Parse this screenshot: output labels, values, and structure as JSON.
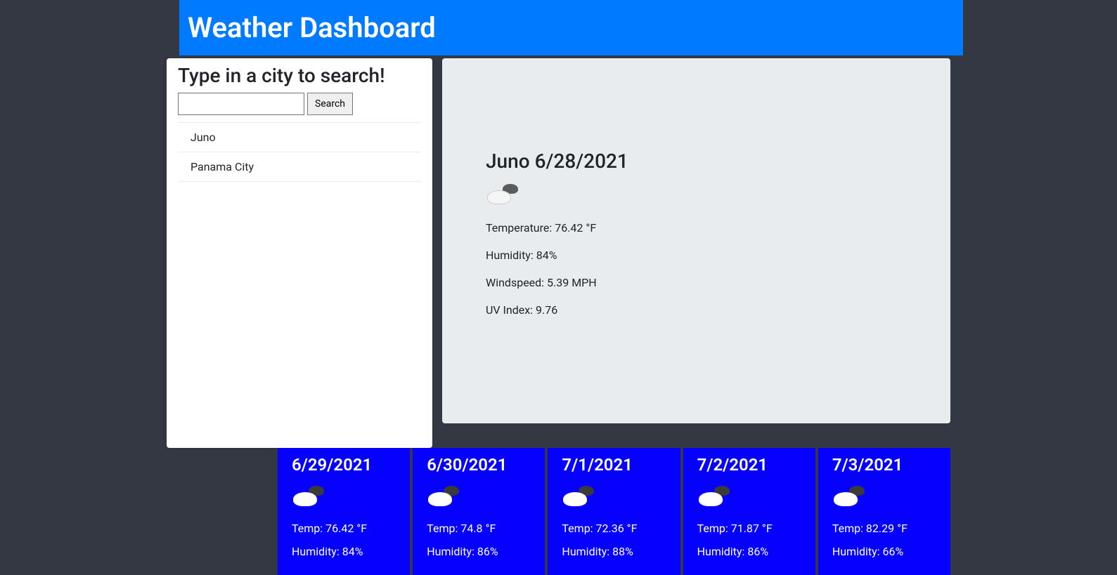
{
  "header": {
    "title": "Weather Dashboard"
  },
  "sidebar": {
    "search_heading": "Type in a city to search!",
    "search_value": "",
    "search_button_label": "Search",
    "history": [
      {
        "label": "Juno"
      },
      {
        "label": "Panama City"
      }
    ]
  },
  "current": {
    "title": "Juno 6/28/2021",
    "icon": "cloud-partly",
    "temperature_label": "Temperature: 76.42 °F",
    "humidity_label": "Humidity: 84%",
    "windspeed_label": "Windspeed: 5.39 MPH",
    "uv_label": "UV Index: 9.76"
  },
  "forecast": [
    {
      "date": "6/29/2021",
      "temp": "Temp: 76.42 °F",
      "humidity": "Humidity: 84%"
    },
    {
      "date": "6/30/2021",
      "temp": "Temp: 74.8 °F",
      "humidity": "Humidity: 86%"
    },
    {
      "date": "7/1/2021",
      "temp": "Temp: 72.36 °F",
      "humidity": "Humidity: 88%"
    },
    {
      "date": "7/2/2021",
      "temp": "Temp: 71.87 °F",
      "humidity": "Humidity: 86%"
    },
    {
      "date": "7/3/2021",
      "temp": "Temp: 82.29 °F",
      "humidity": "Humidity: 66%"
    }
  ]
}
